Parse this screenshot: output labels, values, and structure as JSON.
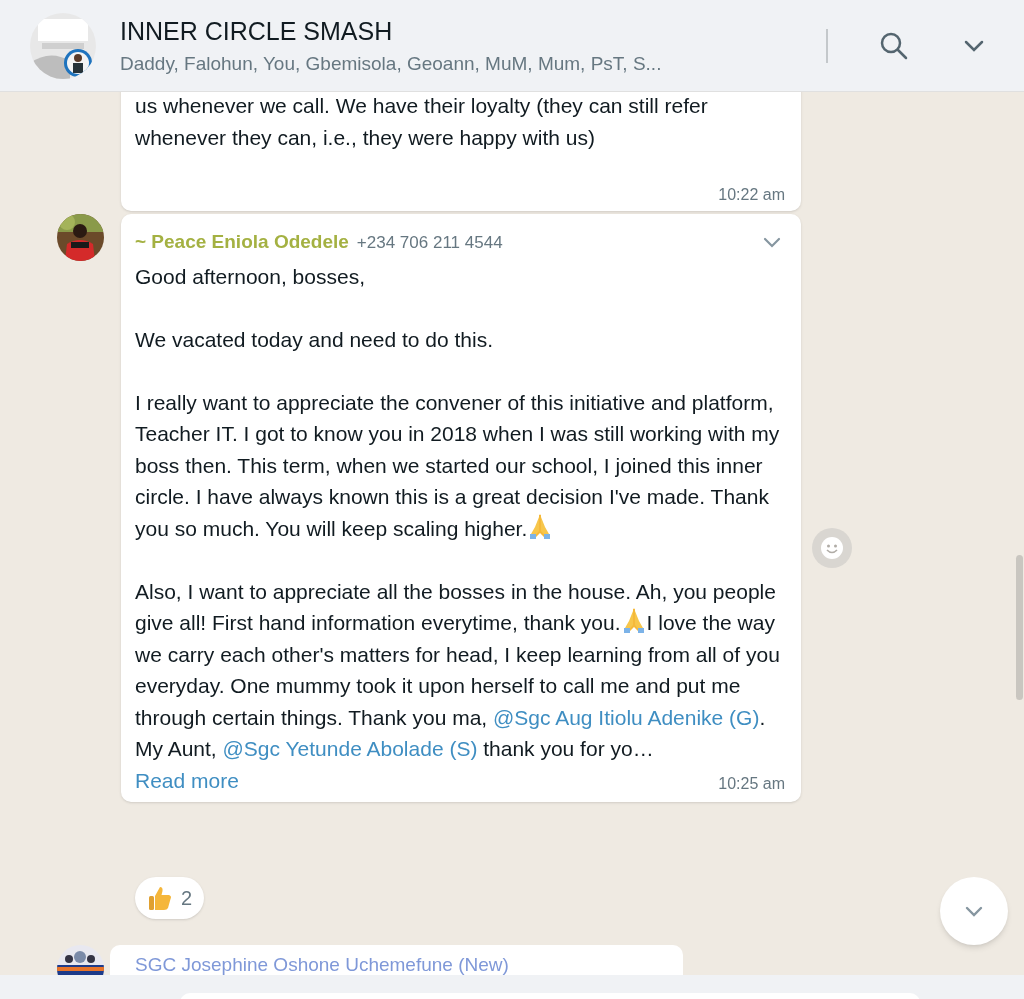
{
  "header": {
    "title": "INNER CIRCLE SMASH",
    "members": "Daddy, Falohun, You, Gbemisola, Geoann, MuM, Mum, PsT, S..."
  },
  "messages": [
    {
      "kind": "continued",
      "paragraphs": [
        [
          {
            "kind": "text",
            "text": "us whenever we call. We have their loyalty (they can still refer whenever they can, i.e., they were happy with us)"
          }
        ]
      ],
      "time": "10:22 am"
    },
    {
      "kind": "full",
      "sender": "~ Peace Eniola Odedele",
      "phone": "+234 706 211 4544",
      "paragraphs": [
        [
          {
            "kind": "text",
            "text": "Good afternoon, bosses,"
          }
        ],
        [
          {
            "kind": "text",
            "text": "We vacated today and need to do this."
          }
        ],
        [
          {
            "kind": "text",
            "text": "I really want to appreciate the convener of this initiative and platform, Teacher IT. I got to know you in 2018 when I was still working with my boss then. This term, when we started our school, I joined this inner circle. I have always known this is a great decision I've made. Thank you so much. You will keep scaling higher."
          },
          {
            "kind": "emoji"
          }
        ],
        [
          {
            "kind": "text",
            "text": "Also, I want to appreciate all the bosses in the house. Ah, you people give all! First hand information everytime, thank you."
          },
          {
            "kind": "emoji"
          },
          {
            "kind": "text",
            "text": "I love the way we carry each other's matters for head, I keep learning from all of you everyday. One mummy took it upon herself to call me and put me through certain things. Thank you ma, "
          },
          {
            "kind": "mention",
            "text": "@Sgc Aug Itiolu Adenike (G)"
          },
          {
            "kind": "text",
            "text": ". My Aunt, "
          },
          {
            "kind": "mention",
            "text": "@Sgc Yetunde Abolade (S)"
          },
          {
            "kind": "text",
            "text": " thank you for yo…"
          }
        ]
      ],
      "read_more": "Read more",
      "time": "10:25 am",
      "reaction_count": "2"
    },
    {
      "kind": "header_only",
      "sender": "SGC Josephine Oshone Uchemefune (New)"
    }
  ]
}
